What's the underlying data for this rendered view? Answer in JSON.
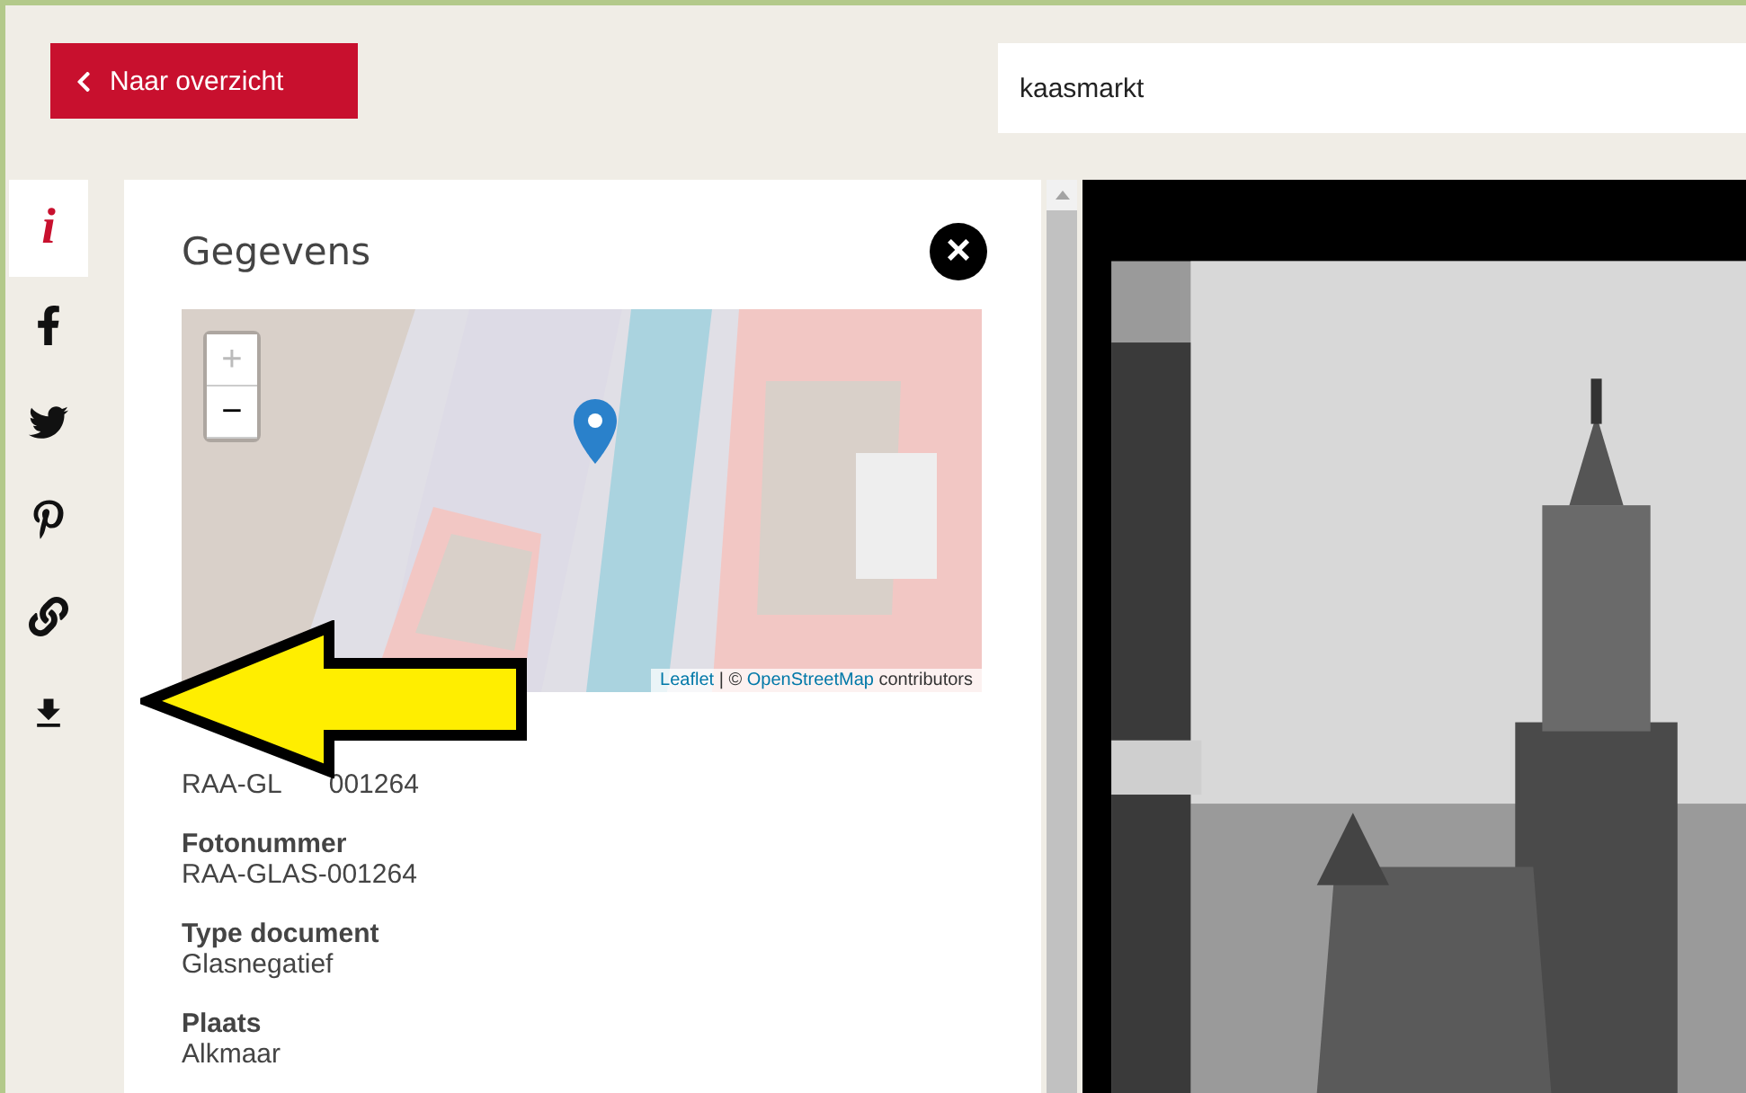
{
  "back_button": {
    "label": "Naar overzicht"
  },
  "search": {
    "value": "kaasmarkt"
  },
  "share_bar": [
    {
      "kind": "info",
      "label": "i",
      "selected": true
    },
    {
      "kind": "facebook",
      "selected": false
    },
    {
      "kind": "twitter",
      "selected": false
    },
    {
      "kind": "pinterest",
      "selected": false
    },
    {
      "kind": "link",
      "selected": false
    },
    {
      "kind": "download",
      "selected": false
    }
  ],
  "panel": {
    "title": "Gegevens",
    "close": "×",
    "map": {
      "zoom_in": "+",
      "zoom_out": "−",
      "attribution_link": "Leaflet",
      "attribution_sep": " | © ",
      "attribution_osm": "OpenStreetMap",
      "attribution_tail": " contributors"
    },
    "fields": [
      {
        "value": "RAA-GL",
        "value_tail": "001264"
      },
      {
        "label": "Fotonummer",
        "value": "RAA-GLAS-001264"
      },
      {
        "label": "Type document",
        "value": "Glasnegatief"
      },
      {
        "label": "Plaats",
        "value": "Alkmaar"
      }
    ]
  }
}
